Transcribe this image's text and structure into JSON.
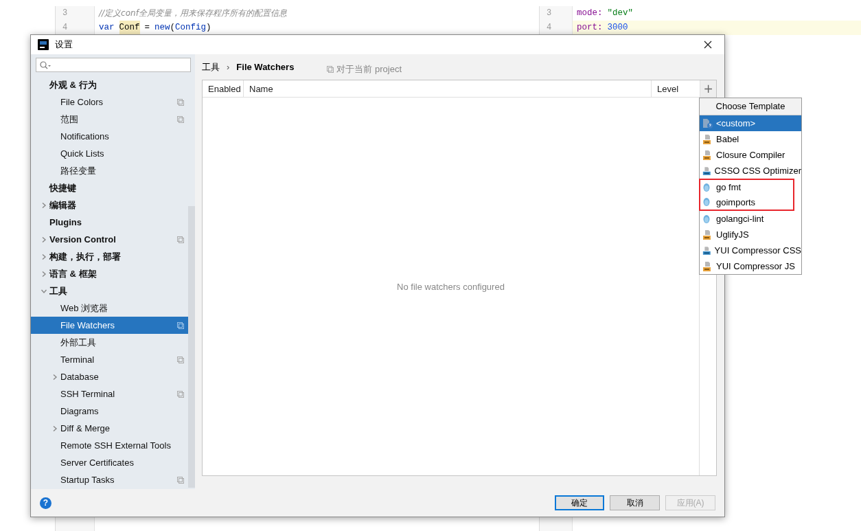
{
  "editors": [
    {
      "lines": [
        {
          "number": "3",
          "current": false,
          "tokens": [
            {
              "text": "//定义conf全局变量，用来保存程序所有的配置信息",
              "kind": "comment"
            }
          ]
        },
        {
          "number": "4",
          "current": false,
          "tokens": [
            {
              "text": "var",
              "kind": "keyword"
            },
            {
              "text": "Conf",
              "kind": "match"
            },
            {
              "text": "=",
              "kind": "plain"
            },
            {
              "text": "new",
              "kind": "keyword"
            },
            {
              "text": "(",
              "kind": "plain"
            },
            {
              "text": "Config",
              "kind": "type"
            },
            {
              "text": ")",
              "kind": "plain"
            }
          ]
        }
      ]
    },
    {
      "lines": [
        {
          "number": "3",
          "current": false,
          "tokens": [
            {
              "text": "mode:",
              "kind": "key"
            },
            {
              "text": "\"dev\"",
              "kind": "string"
            }
          ]
        },
        {
          "number": "4",
          "current": true,
          "tokens": [
            {
              "text": "port:",
              "kind": "key"
            },
            {
              "text": "3000",
              "kind": "number"
            }
          ]
        }
      ]
    }
  ],
  "dialog": {
    "title": "设置",
    "sidebar": {
      "items": [
        {
          "label": "外观 & 行为",
          "selected": false,
          "arrow_shown": false,
          "expanded": true,
          "project_scope": false,
          "children": [
            {
              "label": "File Colors",
              "selected": false,
              "arrow_shown": false,
              "project_scope": true
            },
            {
              "label": "范围",
              "selected": false,
              "arrow_shown": false,
              "project_scope": true
            },
            {
              "label": "Notifications",
              "selected": false,
              "arrow_shown": false,
              "project_scope": false
            },
            {
              "label": "Quick Lists",
              "selected": false,
              "arrow_shown": false,
              "project_scope": false
            },
            {
              "label": "路径变量",
              "selected": false,
              "arrow_shown": false,
              "project_scope": false
            }
          ]
        },
        {
          "label": "快捷键",
          "selected": false,
          "arrow_shown": false,
          "project_scope": false
        },
        {
          "label": "编辑器",
          "selected": false,
          "arrow_shown": true,
          "expanded": false,
          "project_scope": false
        },
        {
          "label": "Plugins",
          "selected": false,
          "arrow_shown": false,
          "project_scope": false
        },
        {
          "label": "Version Control",
          "selected": false,
          "arrow_shown": true,
          "expanded": false,
          "project_scope": true
        },
        {
          "label": "构建，执行，部署",
          "selected": false,
          "arrow_shown": true,
          "expanded": false,
          "project_scope": false
        },
        {
          "label": "语言 & 框架",
          "selected": false,
          "arrow_shown": true,
          "expanded": false,
          "project_scope": false
        },
        {
          "label": "工具",
          "selected": false,
          "arrow_shown": true,
          "expanded": true,
          "project_scope": false,
          "children": [
            {
              "label": "Web 浏览器",
              "selected": false,
              "arrow_shown": false,
              "project_scope": false
            },
            {
              "label": "File Watchers",
              "selected": true,
              "arrow_shown": false,
              "project_scope": true
            },
            {
              "label": "外部工具",
              "selected": false,
              "arrow_shown": false,
              "project_scope": false
            },
            {
              "label": "Terminal",
              "selected": false,
              "arrow_shown": false,
              "project_scope": true
            },
            {
              "label": "Database",
              "selected": false,
              "arrow_shown": true,
              "expanded": false,
              "project_scope": false
            },
            {
              "label": "SSH Terminal",
              "selected": false,
              "arrow_shown": false,
              "project_scope": true
            },
            {
              "label": "Diagrams",
              "selected": false,
              "arrow_shown": false,
              "project_scope": false
            },
            {
              "label": "Diff & Merge",
              "selected": false,
              "arrow_shown": true,
              "expanded": false,
              "project_scope": false
            },
            {
              "label": "Remote SSH External Tools",
              "selected": false,
              "arrow_shown": false,
              "project_scope": false
            },
            {
              "label": "Server Certificates",
              "selected": false,
              "arrow_shown": false,
              "project_scope": false
            },
            {
              "label": "Startup Tasks",
              "selected": false,
              "arrow_shown": false,
              "project_scope": true
            }
          ]
        }
      ]
    },
    "breadcrumb": [
      "工具",
      "File Watchers"
    ],
    "breadcrumb_separator": "›",
    "scope_note": "对于当前 project",
    "table": {
      "columns": [
        "Enabled",
        "Name",
        "Level"
      ],
      "add_button": "+",
      "empty_text": "No file watchers configured"
    },
    "template_menu": {
      "title": "Choose Template",
      "items": [
        {
          "label": "<custom>",
          "kind": "custom",
          "selected": true,
          "highlighted": false
        },
        {
          "label": "Babel",
          "kind": "js",
          "selected": false,
          "highlighted": false
        },
        {
          "label": "Closure Compiler",
          "kind": "js",
          "selected": false,
          "highlighted": false
        },
        {
          "label": "CSSO CSS Optimizer",
          "kind": "css",
          "selected": false,
          "highlighted": false
        },
        {
          "label": "go fmt",
          "kind": "go",
          "selected": false,
          "highlighted": true
        },
        {
          "label": "goimports",
          "kind": "go",
          "selected": false,
          "highlighted": true
        },
        {
          "label": "golangci-lint",
          "kind": "go",
          "selected": false,
          "highlighted": false
        },
        {
          "label": "UglifyJS",
          "kind": "js",
          "selected": false,
          "highlighted": false
        },
        {
          "label": "YUI Compressor CSS",
          "kind": "css",
          "selected": false,
          "highlighted": false
        },
        {
          "label": "YUI Compressor JS",
          "kind": "js",
          "selected": false,
          "highlighted": false
        }
      ]
    },
    "buttons": [
      {
        "label": "确定",
        "kind": "default",
        "disabled": false
      },
      {
        "label": "取消",
        "kind": "normal",
        "disabled": false
      },
      {
        "label": "应用(A)",
        "kind": "normal",
        "disabled": true
      }
    ],
    "help_button": "?"
  }
}
